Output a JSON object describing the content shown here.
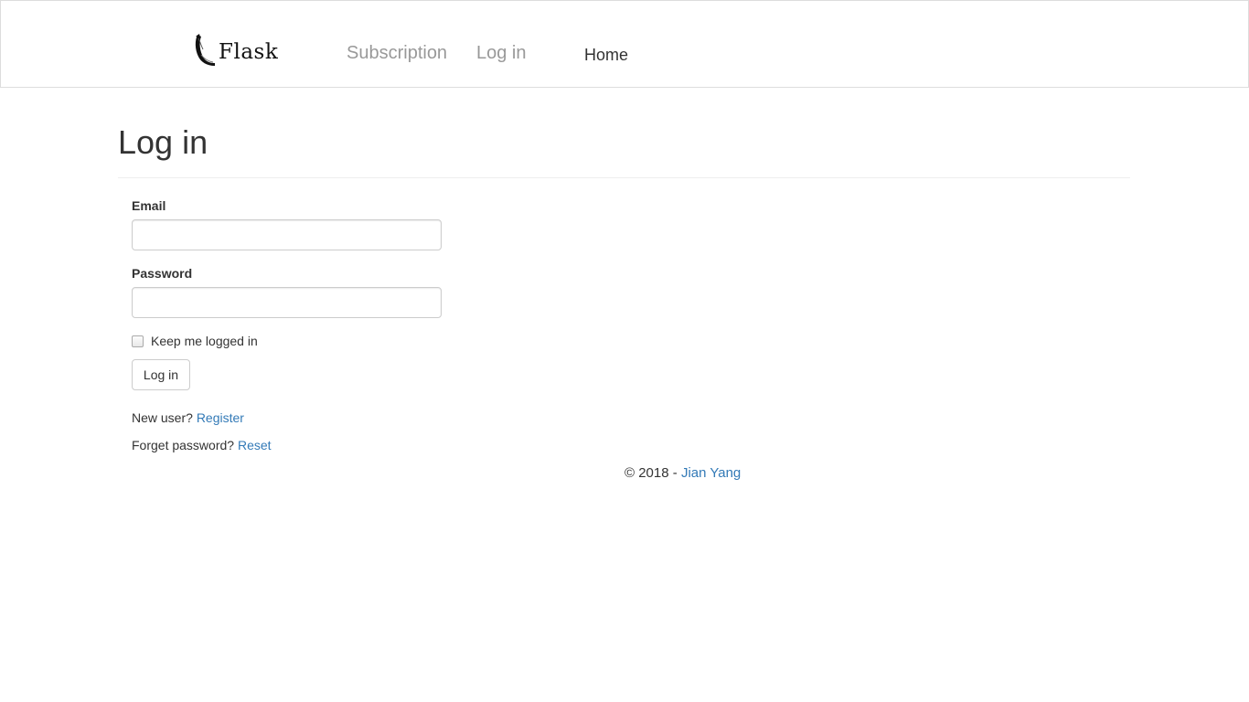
{
  "navbar": {
    "brand_text": "Flask",
    "links": {
      "subscription": "Subscription",
      "login": "Log in",
      "home": "Home"
    }
  },
  "main": {
    "title": "Log in",
    "form": {
      "email_label": "Email",
      "email_value": "",
      "password_label": "Password",
      "password_value": "",
      "remember_label": "Keep me logged in",
      "remember_checked": false,
      "submit_label": "Log in"
    },
    "new_user_text": "New user?",
    "register_link": "Register",
    "forget_text": "Forget password?",
    "reset_link": "Reset"
  },
  "footer": {
    "copyright": "© 2018 -",
    "author_link": "Jian Yang"
  },
  "colors": {
    "link": "#337ab7",
    "nav_muted": "#999999",
    "text": "#333333",
    "border": "#dddddd"
  },
  "icons": {
    "brand_logo": "flask-horn-icon"
  }
}
